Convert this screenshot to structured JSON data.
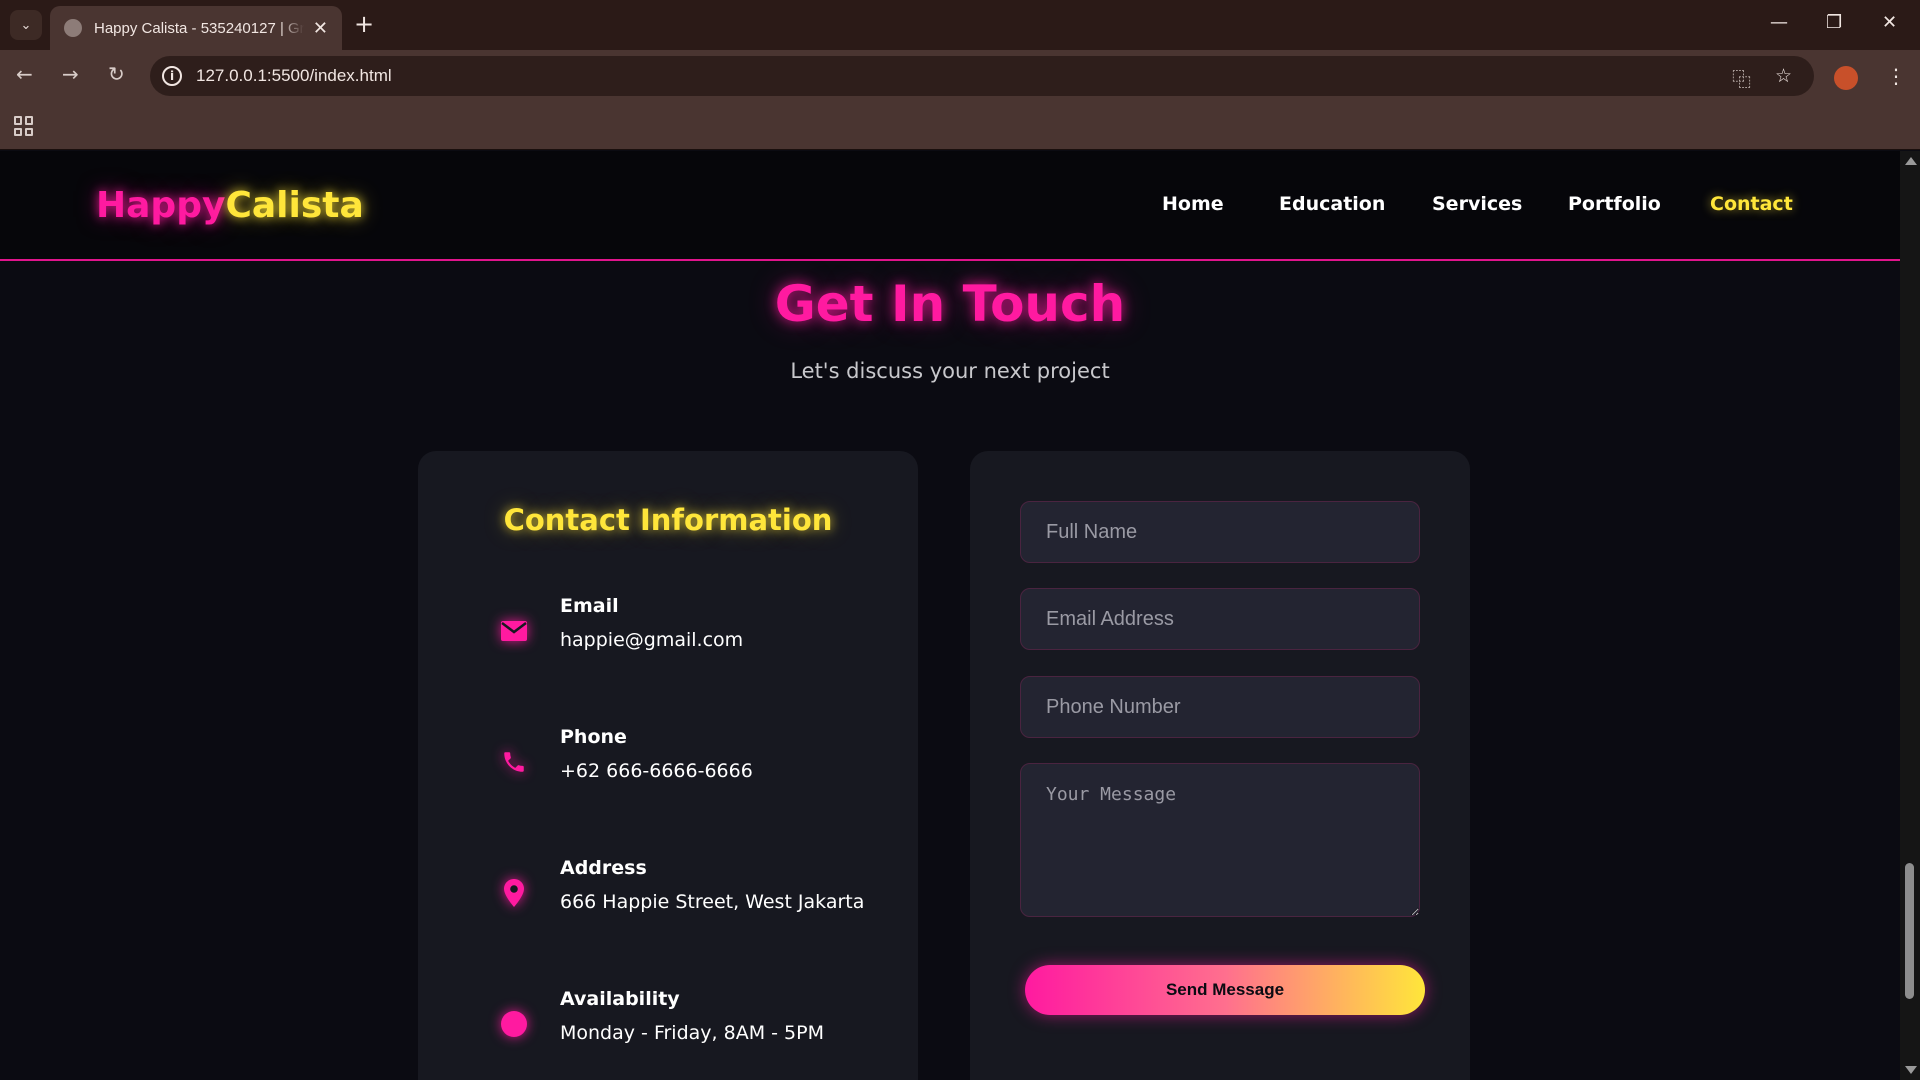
{
  "browser": {
    "tab_title": "Happy Calista - 535240127 | Gr",
    "url": "127.0.0.1:5500/index.html"
  },
  "site": {
    "logo_part1": "Happy",
    "logo_part2": "Calista",
    "nav": [
      {
        "label": "Home"
      },
      {
        "label": "Education"
      },
      {
        "label": "Services"
      },
      {
        "label": "Portfolio"
      },
      {
        "label": "Contact",
        "active": true
      }
    ]
  },
  "hero": {
    "title": "Get In Touch",
    "subtitle": "Let's discuss your next project"
  },
  "contact_info": {
    "title": "Contact Information",
    "items": [
      {
        "icon": "envelope-icon",
        "label": "Email",
        "value": "happie@gmail.com"
      },
      {
        "icon": "phone-icon",
        "label": "Phone",
        "value": "+62 666-6666-6666"
      },
      {
        "icon": "location-pin-icon",
        "label": "Address",
        "value": "666 Happie Street, West Jakarta"
      },
      {
        "icon": "dot-icon",
        "label": "Availability",
        "value": "Monday - Friday, 8AM - 5PM"
      }
    ]
  },
  "form": {
    "name_placeholder": "Full Name",
    "email_placeholder": "Email Address",
    "phone_placeholder": "Phone Number",
    "message_placeholder": "Your Message",
    "submit_label": "Send Message"
  },
  "colors": {
    "accent_pink": "#ff1aa0",
    "accent_yellow": "#ffe63a",
    "background": "#0b0b12",
    "card": "#171820"
  }
}
